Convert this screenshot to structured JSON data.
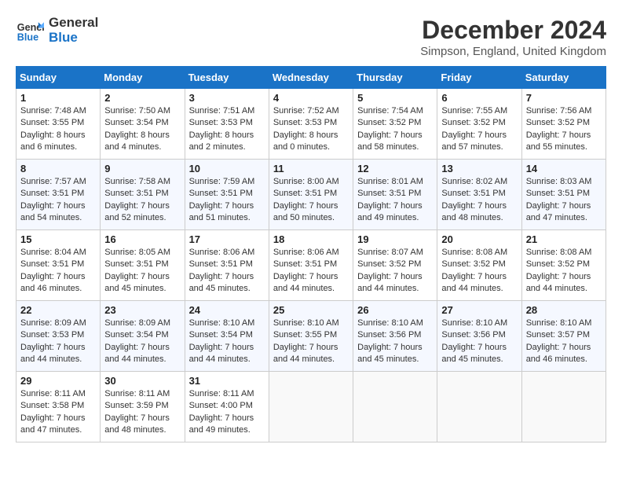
{
  "header": {
    "logo_line1": "General",
    "logo_line2": "Blue",
    "month": "December 2024",
    "location": "Simpson, England, United Kingdom"
  },
  "days_of_week": [
    "Sunday",
    "Monday",
    "Tuesday",
    "Wednesday",
    "Thursday",
    "Friday",
    "Saturday"
  ],
  "weeks": [
    [
      {
        "day": "1",
        "sunrise": "Sunrise: 7:48 AM",
        "sunset": "Sunset: 3:55 PM",
        "daylight": "Daylight: 8 hours and 6 minutes."
      },
      {
        "day": "2",
        "sunrise": "Sunrise: 7:50 AM",
        "sunset": "Sunset: 3:54 PM",
        "daylight": "Daylight: 8 hours and 4 minutes."
      },
      {
        "day": "3",
        "sunrise": "Sunrise: 7:51 AM",
        "sunset": "Sunset: 3:53 PM",
        "daylight": "Daylight: 8 hours and 2 minutes."
      },
      {
        "day": "4",
        "sunrise": "Sunrise: 7:52 AM",
        "sunset": "Sunset: 3:53 PM",
        "daylight": "Daylight: 8 hours and 0 minutes."
      },
      {
        "day": "5",
        "sunrise": "Sunrise: 7:54 AM",
        "sunset": "Sunset: 3:52 PM",
        "daylight": "Daylight: 7 hours and 58 minutes."
      },
      {
        "day": "6",
        "sunrise": "Sunrise: 7:55 AM",
        "sunset": "Sunset: 3:52 PM",
        "daylight": "Daylight: 7 hours and 57 minutes."
      },
      {
        "day": "7",
        "sunrise": "Sunrise: 7:56 AM",
        "sunset": "Sunset: 3:52 PM",
        "daylight": "Daylight: 7 hours and 55 minutes."
      }
    ],
    [
      {
        "day": "8",
        "sunrise": "Sunrise: 7:57 AM",
        "sunset": "Sunset: 3:51 PM",
        "daylight": "Daylight: 7 hours and 54 minutes."
      },
      {
        "day": "9",
        "sunrise": "Sunrise: 7:58 AM",
        "sunset": "Sunset: 3:51 PM",
        "daylight": "Daylight: 7 hours and 52 minutes."
      },
      {
        "day": "10",
        "sunrise": "Sunrise: 7:59 AM",
        "sunset": "Sunset: 3:51 PM",
        "daylight": "Daylight: 7 hours and 51 minutes."
      },
      {
        "day": "11",
        "sunrise": "Sunrise: 8:00 AM",
        "sunset": "Sunset: 3:51 PM",
        "daylight": "Daylight: 7 hours and 50 minutes."
      },
      {
        "day": "12",
        "sunrise": "Sunrise: 8:01 AM",
        "sunset": "Sunset: 3:51 PM",
        "daylight": "Daylight: 7 hours and 49 minutes."
      },
      {
        "day": "13",
        "sunrise": "Sunrise: 8:02 AM",
        "sunset": "Sunset: 3:51 PM",
        "daylight": "Daylight: 7 hours and 48 minutes."
      },
      {
        "day": "14",
        "sunrise": "Sunrise: 8:03 AM",
        "sunset": "Sunset: 3:51 PM",
        "daylight": "Daylight: 7 hours and 47 minutes."
      }
    ],
    [
      {
        "day": "15",
        "sunrise": "Sunrise: 8:04 AM",
        "sunset": "Sunset: 3:51 PM",
        "daylight": "Daylight: 7 hours and 46 minutes."
      },
      {
        "day": "16",
        "sunrise": "Sunrise: 8:05 AM",
        "sunset": "Sunset: 3:51 PM",
        "daylight": "Daylight: 7 hours and 45 minutes."
      },
      {
        "day": "17",
        "sunrise": "Sunrise: 8:06 AM",
        "sunset": "Sunset: 3:51 PM",
        "daylight": "Daylight: 7 hours and 45 minutes."
      },
      {
        "day": "18",
        "sunrise": "Sunrise: 8:06 AM",
        "sunset": "Sunset: 3:51 PM",
        "daylight": "Daylight: 7 hours and 44 minutes."
      },
      {
        "day": "19",
        "sunrise": "Sunrise: 8:07 AM",
        "sunset": "Sunset: 3:52 PM",
        "daylight": "Daylight: 7 hours and 44 minutes."
      },
      {
        "day": "20",
        "sunrise": "Sunrise: 8:08 AM",
        "sunset": "Sunset: 3:52 PM",
        "daylight": "Daylight: 7 hours and 44 minutes."
      },
      {
        "day": "21",
        "sunrise": "Sunrise: 8:08 AM",
        "sunset": "Sunset: 3:52 PM",
        "daylight": "Daylight: 7 hours and 44 minutes."
      }
    ],
    [
      {
        "day": "22",
        "sunrise": "Sunrise: 8:09 AM",
        "sunset": "Sunset: 3:53 PM",
        "daylight": "Daylight: 7 hours and 44 minutes."
      },
      {
        "day": "23",
        "sunrise": "Sunrise: 8:09 AM",
        "sunset": "Sunset: 3:54 PM",
        "daylight": "Daylight: 7 hours and 44 minutes."
      },
      {
        "day": "24",
        "sunrise": "Sunrise: 8:10 AM",
        "sunset": "Sunset: 3:54 PM",
        "daylight": "Daylight: 7 hours and 44 minutes."
      },
      {
        "day": "25",
        "sunrise": "Sunrise: 8:10 AM",
        "sunset": "Sunset: 3:55 PM",
        "daylight": "Daylight: 7 hours and 44 minutes."
      },
      {
        "day": "26",
        "sunrise": "Sunrise: 8:10 AM",
        "sunset": "Sunset: 3:56 PM",
        "daylight": "Daylight: 7 hours and 45 minutes."
      },
      {
        "day": "27",
        "sunrise": "Sunrise: 8:10 AM",
        "sunset": "Sunset: 3:56 PM",
        "daylight": "Daylight: 7 hours and 45 minutes."
      },
      {
        "day": "28",
        "sunrise": "Sunrise: 8:10 AM",
        "sunset": "Sunset: 3:57 PM",
        "daylight": "Daylight: 7 hours and 46 minutes."
      }
    ],
    [
      {
        "day": "29",
        "sunrise": "Sunrise: 8:11 AM",
        "sunset": "Sunset: 3:58 PM",
        "daylight": "Daylight: 7 hours and 47 minutes."
      },
      {
        "day": "30",
        "sunrise": "Sunrise: 8:11 AM",
        "sunset": "Sunset: 3:59 PM",
        "daylight": "Daylight: 7 hours and 48 minutes."
      },
      {
        "day": "31",
        "sunrise": "Sunrise: 8:11 AM",
        "sunset": "Sunset: 4:00 PM",
        "daylight": "Daylight: 7 hours and 49 minutes."
      },
      null,
      null,
      null,
      null
    ]
  ]
}
